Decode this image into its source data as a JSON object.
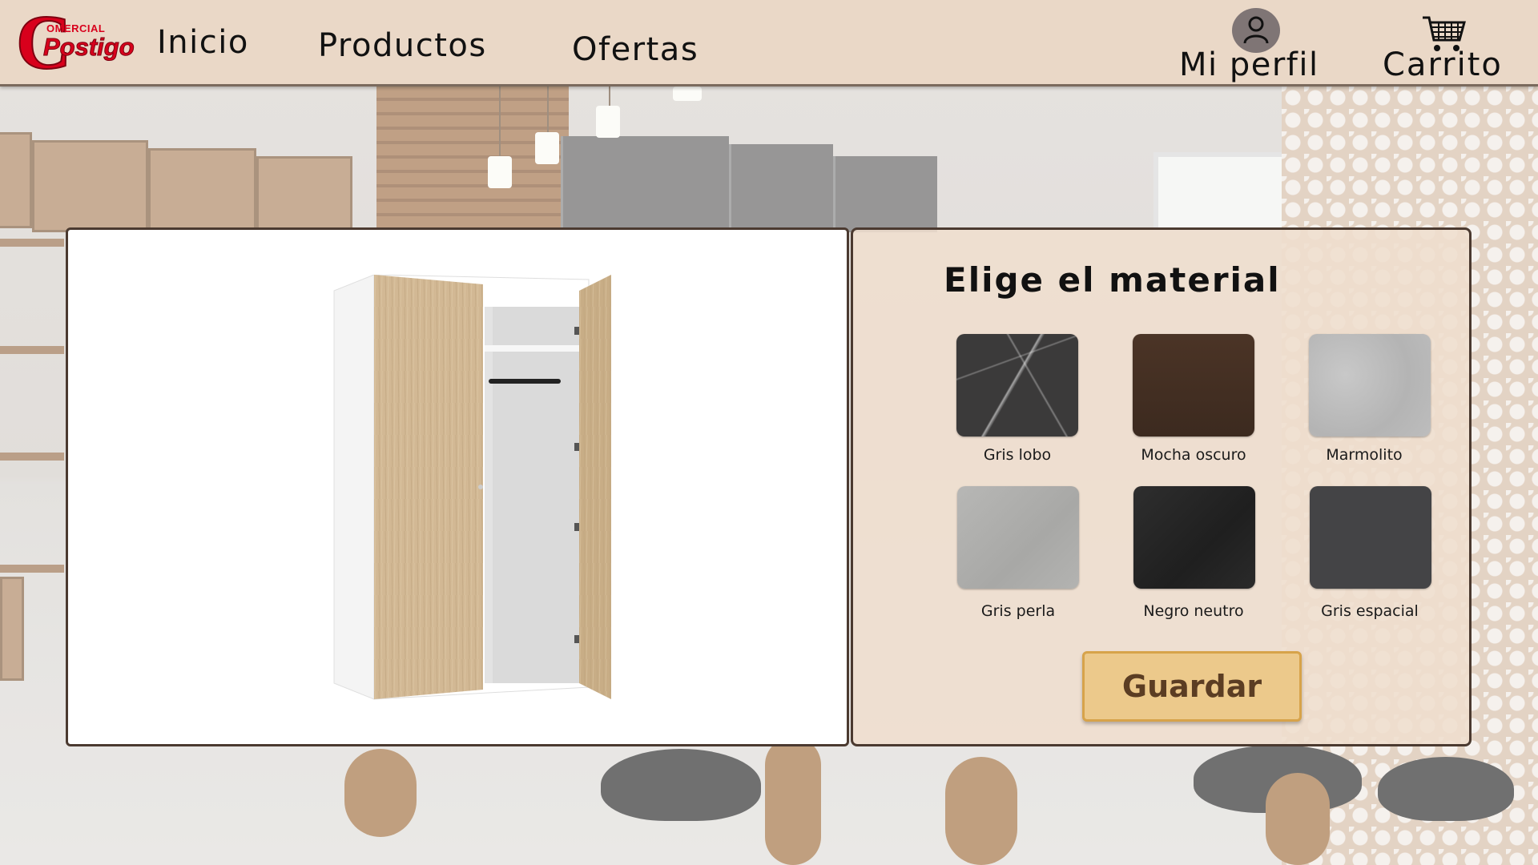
{
  "brand": {
    "top_text": "OMERCIAL",
    "main_text": "Postigo",
    "mark": "C",
    "color": "#d8001c"
  },
  "nav": {
    "items": [
      {
        "label": "Inicio"
      },
      {
        "label": "Productos"
      },
      {
        "label": "Ofertas"
      }
    ]
  },
  "header": {
    "profile_label": "Mi perfil",
    "profile_icon": "user-icon",
    "cart_label": "Carrito",
    "cart_icon": "shopping-cart-icon",
    "background": "#ead8c7"
  },
  "preview": {
    "product_image": "wardrobe-image"
  },
  "materials": {
    "title": "Elige el material",
    "options": [
      {
        "label": "Gris lobo",
        "color": "#3b3a3a"
      },
      {
        "label": "Mocha oscuro",
        "color": "#45301f"
      },
      {
        "label": "Marmolito",
        "color": "#bdbdbd"
      },
      {
        "label": "Gris perla",
        "color": "#b1b1af"
      },
      {
        "label": "Negro neutro",
        "color": "#262626"
      },
      {
        "label": "Gris espacial",
        "color": "#444446"
      }
    ],
    "save_label": "Guardar",
    "save_color": "#ecc98b"
  }
}
